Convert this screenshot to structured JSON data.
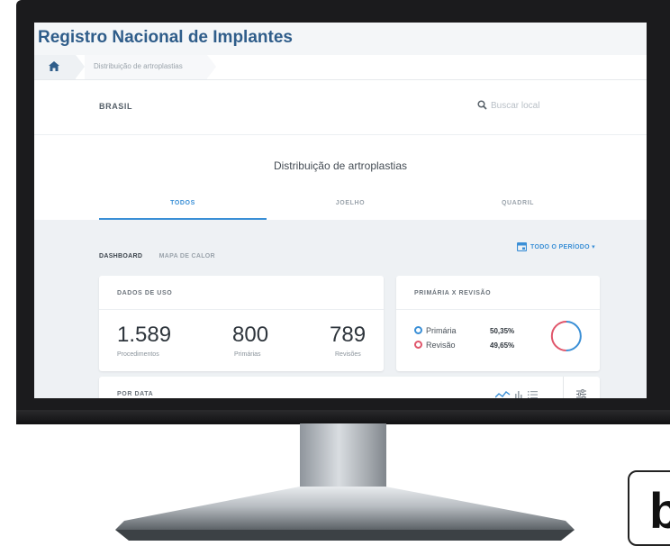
{
  "app": {
    "title": "Registro Nacional de Implantes"
  },
  "breadcrumb": {
    "home_icon": "home-icon",
    "current": "Distribuição de artroplastias"
  },
  "location": {
    "label": "BRASIL",
    "search_placeholder": "Buscar local",
    "search_icon": "search-icon"
  },
  "section": {
    "title": "Distribuição de artroplastias"
  },
  "tabs": [
    {
      "label": "TODOS",
      "active": true
    },
    {
      "label": "JOELHO",
      "active": false
    },
    {
      "label": "QUADRIL",
      "active": false
    }
  ],
  "views": [
    {
      "label": "DASHBOARD",
      "active": true
    },
    {
      "label": "MAPA DE CALOR",
      "active": false
    }
  ],
  "period": {
    "label": "TODO O PERÍODO ▾",
    "icon": "calendar-icon"
  },
  "usage_card": {
    "title": "DADOS DE USO",
    "stats": [
      {
        "value": "1.589",
        "label": "Procedimentos"
      },
      {
        "value": "800",
        "label": "Primárias"
      },
      {
        "value": "789",
        "label": "Revisões"
      }
    ]
  },
  "revision_card": {
    "title": "PRIMÁRIA X REVISÃO",
    "items": [
      {
        "label": "Primária",
        "percent": "50,35%",
        "color": "#3a8fd6",
        "share": 0.5035
      },
      {
        "label": "Revisão",
        "percent": "49,65%",
        "color": "#e0566b",
        "share": 0.4965
      }
    ]
  },
  "date_card": {
    "title": "POR DATA",
    "icons": [
      "line-chart-icon",
      "bar-chart-icon",
      "list-icon",
      "settings-icon"
    ]
  },
  "colors": {
    "accent": "#3a8fd6",
    "title": "#2f5d8a",
    "revision": "#e0566b"
  },
  "corner": {
    "letter": "b"
  }
}
